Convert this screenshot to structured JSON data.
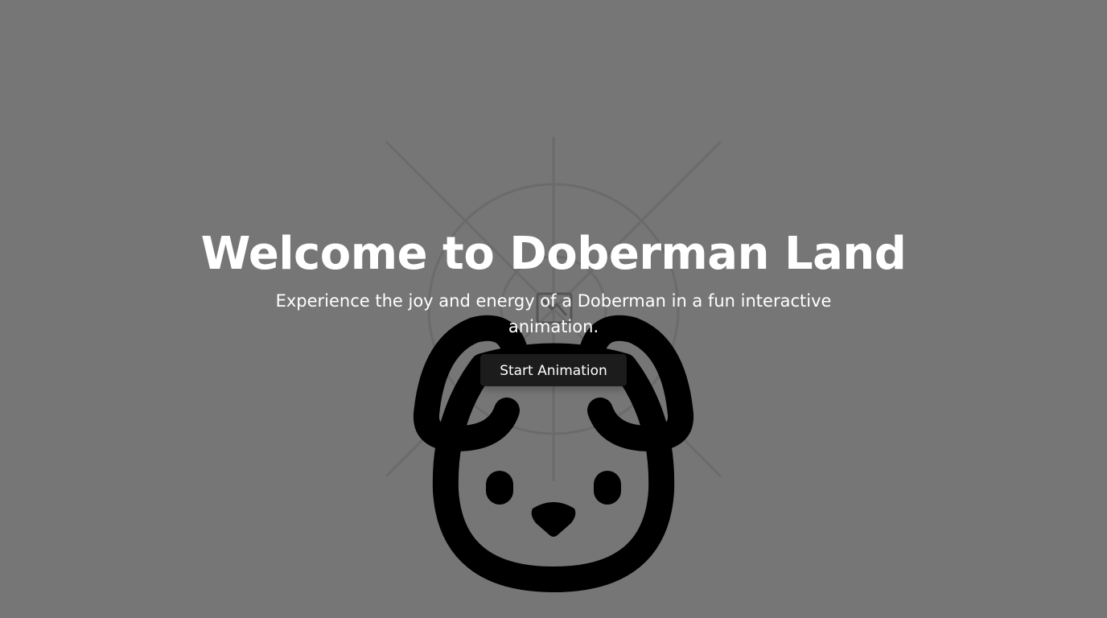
{
  "hero": {
    "title": "Welcome to Doberman Land",
    "subtitle": "Experience the joy and energy of a Doberman in a fun interactive animation.",
    "button_label": "Start Animation"
  },
  "colors": {
    "background": "#767676",
    "text": "#ffffff",
    "button_bg": "#1c1c1c",
    "dog_stroke": "#000000"
  },
  "icons": {
    "mascot": "dog-face-icon",
    "background_graphic": "radial-rays-graphic",
    "broken_image": "broken-image-icon"
  }
}
